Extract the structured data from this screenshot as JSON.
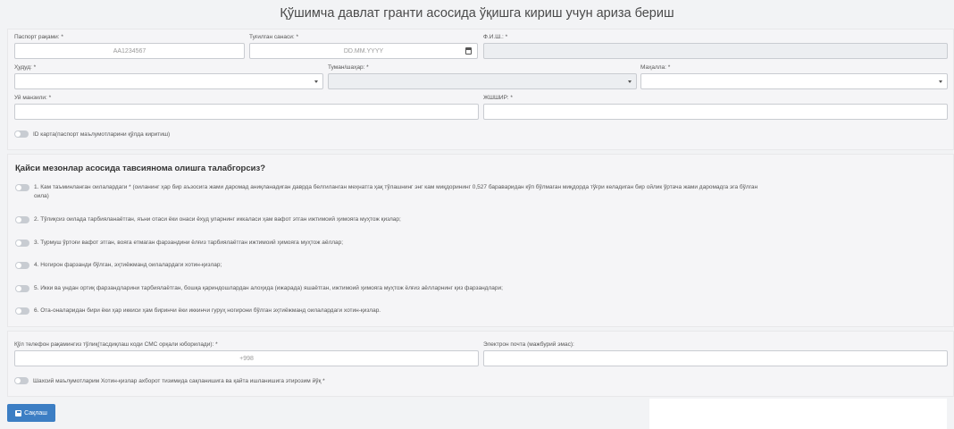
{
  "title": "Қўшимча давлат гранти асосида ўқишга кириш учун ариза бериш",
  "personal": {
    "passport_label": "Паспорт рақами: *",
    "passport_placeholder": "AA1234567",
    "birthdate_label": "Туғилган санаси: *",
    "birthdate_placeholder": "DD.MM.YYYY",
    "fio_label": "Ф.И.Ш.: *",
    "region_label": "Ҳудуд: *",
    "district_label": "Туман/шаҳар: *",
    "mahalla_label": "Маҳалла: *",
    "address_label": "Уй манзили: *",
    "pinfl_label": "ЖШШИР: *",
    "id_card_toggle": "ID карта(паспорт маълумотларини қўлда киритиш)"
  },
  "criteria": {
    "question": "Қайси мезонлар асосида тавсиянома олишга талабгорсиз?",
    "options": [
      "1. Кам таъминланган оилалардаги * (оиланинг ҳар бир аъзосига жами даромад аниқланадиган даврда белгиланган меҳнатга ҳақ тўлашнинг энг кам миқдорининг 0,527 баравaридан кўп бўлмаган миқдорда тўғри келадиган бир ойлик ўртача жами даромадга эга бўлган",
      "оила)",
      "2. Тўлиқсиз оилада тарбияланаётган, яъни отаси ёки онаси ёхуд уларнинг иккаласи ҳам вафот этган ижтимоий ҳимояга муҳтож қизлар;",
      "3. Турмуш ўртоғи вафот этган, вояга етмаган фарзандини ёлғиз тарбиялаётган ижтимоий ҳимояга муҳтож аёллар;",
      "4. Ногирон фарзанди бўлган, эҳтиёжманд оилалардаги хотин-қизлар;",
      "5. Икки ва ундан ортиқ фарзандларини тарбиялаётган, бошқа қариндошлардан алоҳида (ижарада) яшаётган, ижтимоий ҳимояга муҳтож ёлғиз аёлларнинг қиз фарзандлари;",
      "6. Ота-оналаридан бири ёки ҳар иккиси ҳам биринчи ёки иккинчи гуруҳ ногирони бўлган эҳтиёжманд оилалардаги хотин-қизлар."
    ]
  },
  "contact": {
    "phone_label": "Қўл телефон рақамингиз тўлиқ(тасдиқлаш коди СМС орқали юборилади): *",
    "phone_placeholder": "+998",
    "email_label": "Электрон почта (мажбурий эмас):",
    "consent_toggle": "Шахсий маълумотларим Хотин-қизлар ахборот тизимида сақланишига ва қайта ишланишига этирозим йўқ *"
  },
  "save_label": "Сақлаш"
}
